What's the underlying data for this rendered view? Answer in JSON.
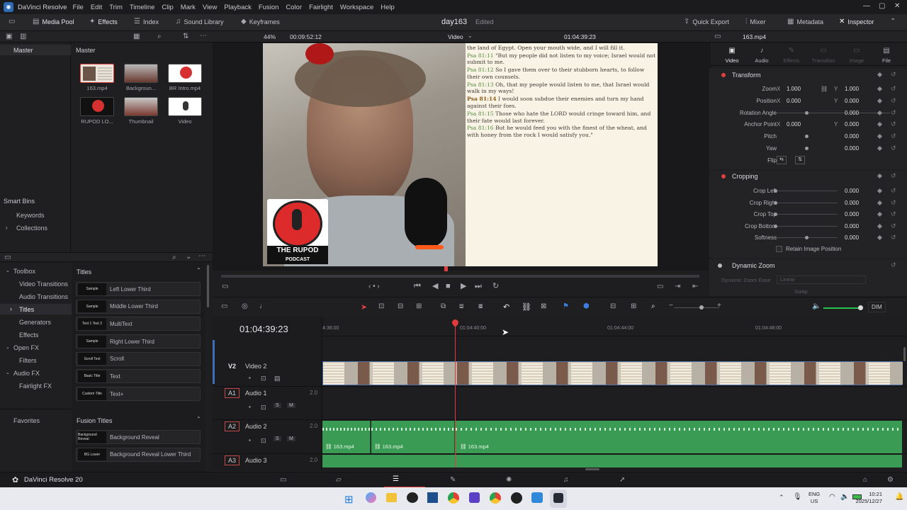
{
  "menubar": {
    "app": "DaVinci Resolve",
    "items": [
      "File",
      "Edit",
      "Trim",
      "Timeline",
      "Clip",
      "Mark",
      "View",
      "Playback",
      "Fusion",
      "Color",
      "Fairlight",
      "Workspace",
      "Help"
    ]
  },
  "toolbar": {
    "media_pool": "Media Pool",
    "effects": "Effects",
    "index": "Index",
    "sound_library": "Sound Library",
    "keyframes": "Keyframes",
    "project": "day163",
    "status": "Edited",
    "quick_export": "Quick Export",
    "mixer": "Mixer",
    "metadata": "Metadata",
    "inspector": "Inspector"
  },
  "strip": {
    "zoom": "44%",
    "tc_left": "00:09:52:12",
    "viewer_mode": "Video",
    "tc_right": "01:04:39:23",
    "clip": "163.mp4"
  },
  "media": {
    "master_left": "Master",
    "master_right": "Master",
    "clips": [
      {
        "name": "163.mp4",
        "kind": "video"
      },
      {
        "name": "Backgroun...",
        "kind": "bg"
      },
      {
        "name": "BR Intro.mp4",
        "kind": "logo"
      },
      {
        "name": "RUPOD LO...",
        "kind": "logo2"
      },
      {
        "name": "Thumbnail",
        "kind": "bg"
      },
      {
        "name": "Video",
        "kind": "mic"
      }
    ]
  },
  "smart_bins": {
    "title": "Smart Bins",
    "items": [
      "Keywords",
      "Collections"
    ]
  },
  "toolbox": {
    "items": [
      "Toolbox",
      "Video Transitions",
      "Audio Transitions",
      "Titles",
      "Generators",
      "Effects",
      "Open FX",
      "Filters",
      "Audio FX",
      "Fairlight FX"
    ],
    "favorites": "Favorites"
  },
  "titles": {
    "header": "Titles",
    "items": [
      {
        "label": "Left Lower Third",
        "pv": "Sample"
      },
      {
        "label": "Middle Lower Third",
        "pv": "Sample"
      },
      {
        "label": "MultiText",
        "pv": "Text 1 Text 2"
      },
      {
        "label": "Right Lower Third",
        "pv": "Sample"
      },
      {
        "label": "Scroll",
        "pv": "Scroll Text"
      },
      {
        "label": "Text",
        "pv": "Basic Title"
      },
      {
        "label": "Text+",
        "pv": "Custom Title"
      }
    ],
    "fusion_header": "Fusion Titles",
    "fusion_items": [
      {
        "label": "Background Reveal",
        "pv": "Background Reveal"
      },
      {
        "label": "Background Reveal Lower Third",
        "pv": "BG Lower"
      }
    ]
  },
  "viewer": {
    "podcast_top": "THE RUPOD",
    "podcast_bottom": "PODCAST",
    "verses": [
      {
        "ref": "",
        "text": "the land of Egypt. Open your mouth wide, and I will fill it."
      },
      {
        "ref": "Psa 81:11",
        "text": "\"But my people did not listen to my voice; Israel would not submit to me."
      },
      {
        "ref": "Psa 81:12",
        "text": "So I gave them over to their stubborn hearts, to follow their own counsels."
      },
      {
        "ref": "Psa 81:13",
        "text": "Oh, that my people would listen to me, that Israel would walk in my ways!"
      },
      {
        "ref": "Psa 81:14",
        "text": "I would soon subdue their enemies and turn my hand against their foes."
      },
      {
        "ref": "Psa 81:15",
        "text": "Those who hate the LORD would cringe toward him, and their fate would last forever."
      },
      {
        "ref": "Psa 81:16",
        "text": "But he would feed you with the finest of the wheat, and with honey from the rock I would satisfy you.\""
      }
    ]
  },
  "inspector": {
    "tabs": [
      "Video",
      "Audio",
      "Effects",
      "Transition",
      "Image",
      "File"
    ],
    "transform": "Transform",
    "zoom": "Zoom",
    "position": "Position",
    "rotation": "Rotation Angle",
    "anchor": "Anchor Point",
    "pitch": "Pitch",
    "yaw": "Yaw",
    "flip": "Flip",
    "zoom_x": "1.000",
    "zoom_y": "1.000",
    "pos_x": "0.000",
    "pos_y": "0.000",
    "rot": "0.000",
    "anc_x": "0.000",
    "anc_y": "0.000",
    "pitch_v": "0.000",
    "yaw_v": "0.000",
    "cropping": "Cropping",
    "crop_left": "Crop Left",
    "crop_right": "Crop Right",
    "crop_top": "Crop Top",
    "crop_bottom": "Crop Bottom",
    "softness": "Softness",
    "cl": "0.000",
    "cr": "0.000",
    "ct": "0.000",
    "cb": "0.000",
    "sf": "0.000",
    "retain": "Retain Image Position",
    "dynamic_zoom": "Dynamic Zoom",
    "dz_ease": "Dynamic Zoom Ease",
    "dz_linear": "Linear",
    "swap": "Swap",
    "x": "X",
    "y": "Y"
  },
  "timeline": {
    "timecode": "01:04:39:23",
    "ruler": [
      "4:36:00",
      "01:04:40:00",
      "01:04:44:00",
      "01:04:48:00"
    ],
    "tracks": [
      {
        "id": "V2",
        "name": "Video 2"
      },
      {
        "id": "A1",
        "name": "Audio 1",
        "level": "2.0"
      },
      {
        "id": "A2",
        "name": "Audio 2",
        "level": "2.0"
      },
      {
        "id": "A3",
        "name": "Audio 3",
        "level": "2.0"
      }
    ],
    "clips": [
      "163.mp4",
      "163.mp4",
      "163.mp4"
    ],
    "dim": "DIM",
    "s": "S",
    "m": "M"
  },
  "footer": {
    "app": "DaVinci Resolve 20"
  },
  "taskbar": {
    "lang1": "ENG",
    "lang2": "US",
    "time": "10:21",
    "date": "2025/12/27"
  }
}
